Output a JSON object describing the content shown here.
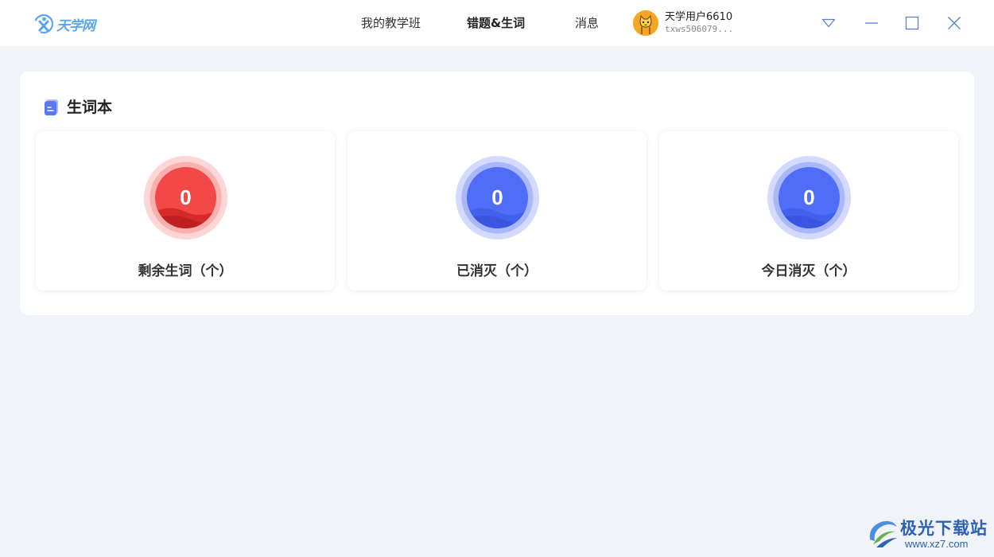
{
  "app": {
    "logo_text": "天学网"
  },
  "nav": {
    "items": [
      {
        "label": "我的教学班"
      },
      {
        "label": "错题&生词"
      },
      {
        "label": "消息"
      }
    ]
  },
  "user": {
    "name": "天学用户6610",
    "id": "txws506079..."
  },
  "panel": {
    "title": "生词本",
    "stats": [
      {
        "label": "剩余生词（个）",
        "value": "0",
        "color": "#f04343"
      },
      {
        "label": "已消灭（个）",
        "value": "0",
        "color": "#4a6cf7"
      },
      {
        "label": "今日消灭（个）",
        "value": "0",
        "color": "#4a6cf7"
      }
    ]
  },
  "watermark": {
    "text": "极光下载站",
    "url": "www.xz7.com"
  },
  "colors": {
    "accent": "#5aa6ee",
    "red": "#f04343",
    "blue": "#4a6cf7",
    "background": "#f0f3f8"
  }
}
